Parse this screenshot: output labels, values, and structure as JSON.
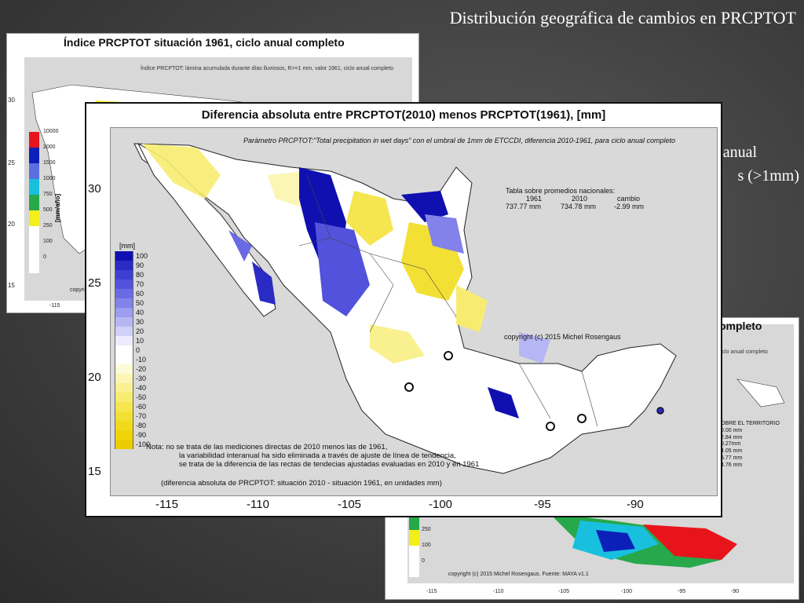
{
  "slide": {
    "title": "Distribución geográfica de cambios en PRCPTOT",
    "side_line1": "anual",
    "side_line2": "s (>1mm)"
  },
  "back_panel": {
    "title": "Índice PRCPTOT situación 1961, ciclo anual completo",
    "description": "Índice PRCPTOT: lámina acumulada durante días lluviosos, R>=1 mm, valor 1961, ciclo anual completo",
    "unit": "[mm/año]",
    "copyright": "copyri",
    "y_ticks": [
      "30",
      "25",
      "20",
      "15"
    ],
    "x_ticks": [
      "-115"
    ],
    "legend": [
      {
        "label": "10000",
        "color": "#e8141c"
      },
      {
        "label": "2000",
        "color": "#0b20b8"
      },
      {
        "label": "1500",
        "color": "#5c6fe0"
      },
      {
        "label": "1000",
        "color": "#18c0de"
      },
      {
        "label": "750",
        "color": "#27a84a"
      },
      {
        "label": "500",
        "color": "#f2ef1a"
      },
      {
        "label": "250",
        "color": "#ffffff"
      },
      {
        "label": "100",
        "color": "#ffffff"
      },
      {
        "label": "0",
        "color": "#ffffff"
      }
    ]
  },
  "back_panel2": {
    "title": "ompleto",
    "description": "iclo anual completo",
    "table": [
      "OBRE EL TERRITORIO",
      "0.00 mm",
      "2.84 mm",
      "0.27mm",
      "4.05 mm",
      "5.77 mm",
      "4.76 mm"
    ],
    "copyright": "copyright (c) 2015 Michel Rosengaus. Fuente: MAYA v1.1",
    "x_ticks": [
      "-115",
      "-110",
      "-105",
      "-100",
      "-95",
      "-90"
    ],
    "legend": [
      {
        "label": "500",
        "color": "#27a84a"
      },
      {
        "label": "250",
        "color": "#f2ef1a"
      },
      {
        "label": "100",
        "color": "#ffffff"
      },
      {
        "label": "0",
        "color": "#ffffff"
      }
    ]
  },
  "main_panel": {
    "title": "Diferencia absoluta entre PRCPTOT(2010) menos PRCPTOT(1961), [mm]",
    "subtitle": "Parámetro PRCPTOT:\"Total precipitation in wet days\" con el umbral de 1mm de ETCCDI, diferencia 2010-1961,  para ciclo anual completo",
    "unit": "[mm]",
    "table_title": "Tabla sobre promedios nacionales:",
    "table_headers": [
      "1961",
      "2010",
      "cambio"
    ],
    "table_values": [
      "737.77 mm",
      "734.78 mm",
      "-2.99 mm"
    ],
    "copyright": "copyright (c) 2015 Michel Rosengaus",
    "note_lines": [
      "Nota: no se trata de las mediciones directas de 2010 menos las de 1961,",
      "la variabilidad interanual ha sido eliminada a través de ajuste de línea de tendencia,",
      "se trata de la diferencia de las rectas de tendecias ajustadas evaluadas en 2010 y en 1961"
    ],
    "note_bottom": "(diferencia absoluta de PRCPTOT: situación 2010 - situación 1961, en unidades mm)",
    "y_ticks": [
      "30",
      "25",
      "20",
      "15"
    ],
    "x_ticks": [
      "-115",
      "-110",
      "-105",
      "-100",
      "-95",
      "-90"
    ],
    "legend": [
      {
        "label": "100",
        "color": "#1010b0"
      },
      {
        "label": "90",
        "color": "#2a2ac4"
      },
      {
        "label": "80",
        "color": "#3e3ed2"
      },
      {
        "label": "70",
        "color": "#5252dc"
      },
      {
        "label": "60",
        "color": "#6a6ae4"
      },
      {
        "label": "50",
        "color": "#8282ea"
      },
      {
        "label": "40",
        "color": "#9c9cf0"
      },
      {
        "label": "30",
        "color": "#b6b6f4"
      },
      {
        "label": "20",
        "color": "#d0d0f8"
      },
      {
        "label": "10",
        "color": "#ececfc"
      },
      {
        "label": "0",
        "color": "#ffffff"
      },
      {
        "label": "-10",
        "color": "#ffffff"
      },
      {
        "label": "-20",
        "color": "#fdfbd8"
      },
      {
        "label": "-30",
        "color": "#fbf6b4"
      },
      {
        "label": "-40",
        "color": "#f9f190"
      },
      {
        "label": "-50",
        "color": "#f7ec70"
      },
      {
        "label": "-60",
        "color": "#f5e650"
      },
      {
        "label": "-70",
        "color": "#f3e034"
      },
      {
        "label": "-80",
        "color": "#f1da1c"
      },
      {
        "label": "-90",
        "color": "#efd40a"
      },
      {
        "label": "-100",
        "color": "#ebcc00"
      }
    ]
  }
}
